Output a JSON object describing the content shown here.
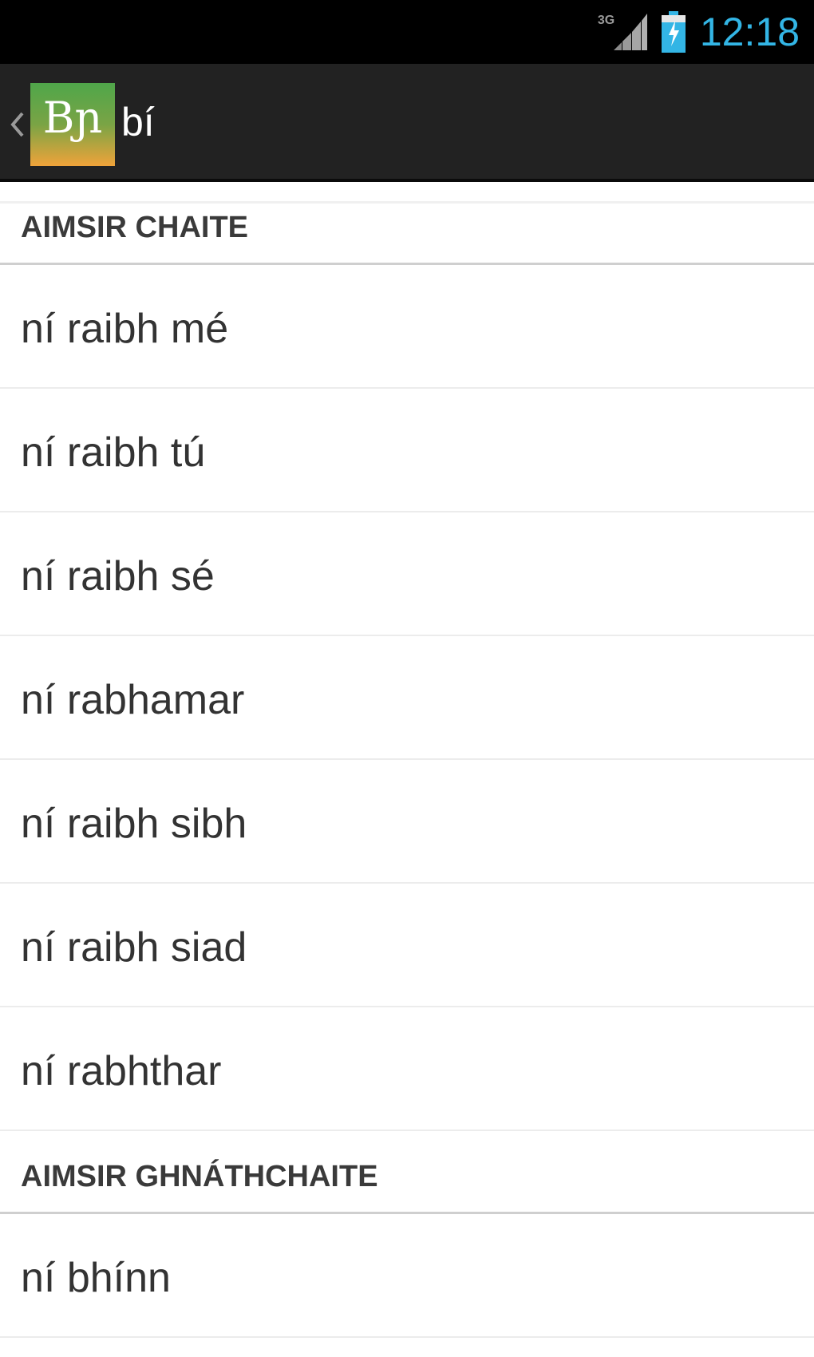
{
  "status_bar": {
    "network_label": "3G",
    "time": "12:18",
    "signal_icon": "signal-icon",
    "battery_icon": "battery-charging-icon",
    "clock_color": "#33b5e5"
  },
  "action_bar": {
    "up_icon": "chevron-left-icon",
    "logo_text": "Bɲ",
    "title": "bí"
  },
  "sections": [
    {
      "header": "AIMSIR CHAITE",
      "items": [
        "ní raibh mé",
        "ní raibh tú",
        "ní raibh sé",
        "ní rabhamar",
        "ní raibh sibh",
        "ní raibh siad",
        "ní rabhthar"
      ]
    },
    {
      "header": "AIMSIR GHNÁTHCHAITE",
      "items": [
        "ní bhínn"
      ]
    }
  ]
}
